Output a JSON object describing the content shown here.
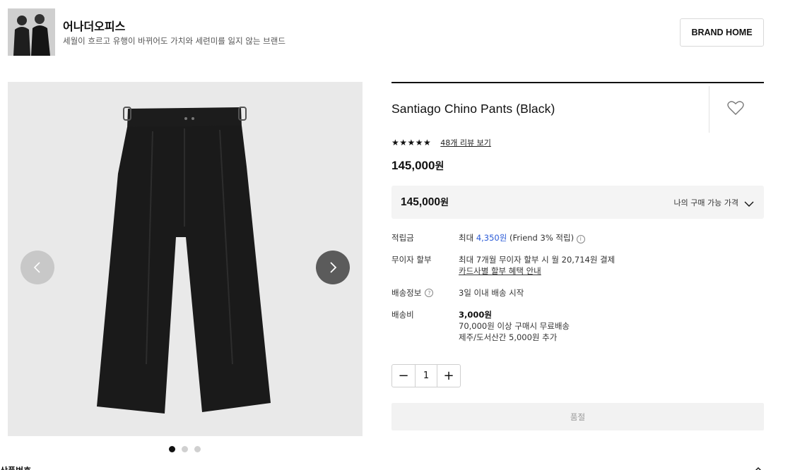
{
  "brand": {
    "name": "어나더오피스",
    "description": "세월이 흐르고 유행이 바뀌어도 가치와 세련미를 잃지 않는 브랜드",
    "home_button": "BRAND HOME"
  },
  "gallery": {
    "dots_total": 3,
    "active_dot": 1
  },
  "product": {
    "title": "Santiago Chino Pants (Black)",
    "stars": "★★★★★",
    "review_link": "48개 리뷰 보기",
    "price_num": "145,000",
    "price_unit": "원",
    "my_price_num": "145,000",
    "my_price_unit": "원",
    "my_price_label": "나의 구매 가능 가격"
  },
  "info": {
    "points_label": "적립금",
    "points_prefix": "최대",
    "points_amount": "4,350원",
    "points_suffix": "(Friend 3% 적립)",
    "installment_label": "무이자 할부",
    "installment_text": "최대 7개월 무이자 할부 시 월 20,714원 결제",
    "installment_link": "카드사별 할부 혜택 안내",
    "shipping_label": "배송정보",
    "shipping_text": "3일 이내 배송 시작",
    "fee_label": "배송비",
    "fee_amount": "3,000원",
    "fee_free": "70,000원 이상 구매시 무료배송",
    "fee_island": "제주/도서산간 5,000원 추가"
  },
  "quantity": {
    "minus": "−",
    "value": "1",
    "plus": "+"
  },
  "soldout_button": "품절",
  "bottom": {
    "section_label": "상품번호"
  },
  "colors": {
    "accent": "#2b5bd7",
    "soldout_bg": "#f2f2f2",
    "price_box_bg": "#f4f4f4"
  }
}
